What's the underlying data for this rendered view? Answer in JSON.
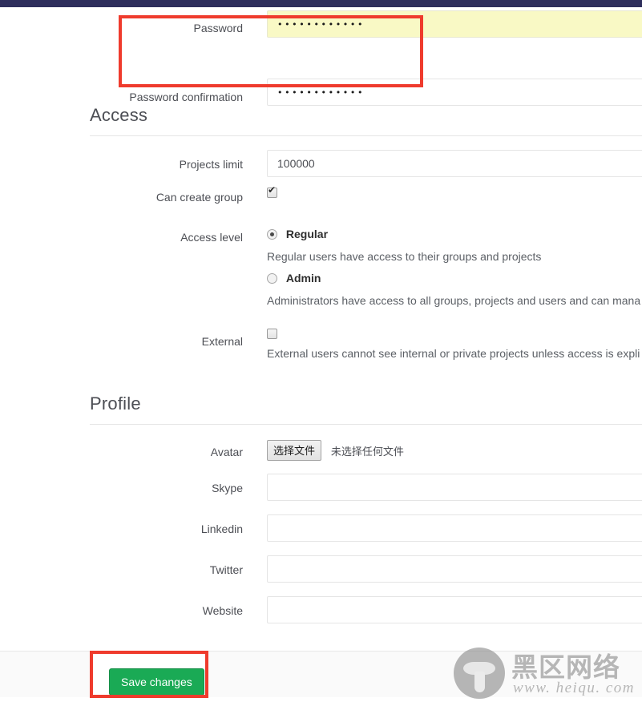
{
  "theme": {
    "topbar_color": "#2e2e5c",
    "accent_green": "#1aaa55",
    "annotation_red": "#ef3b2d",
    "autofill_yellow": "#f9f9c5"
  },
  "password_section": {
    "fields": [
      {
        "label": "Password",
        "value": "••••••••••••",
        "autofilled": true
      },
      {
        "label": "Password confirmation",
        "value": "••••••••••••",
        "autofilled": false
      }
    ]
  },
  "access_section": {
    "title": "Access",
    "projects_limit": {
      "label": "Projects limit",
      "value": "100000"
    },
    "can_create_group": {
      "label": "Can create group",
      "checked": true
    },
    "access_level": {
      "label": "Access level",
      "options": [
        {
          "value": "regular",
          "label": "Regular",
          "selected": true,
          "help": "Regular users have access to their groups and projects"
        },
        {
          "value": "admin",
          "label": "Admin",
          "selected": false,
          "help": "Administrators have access to all groups, projects and users and can mana"
        }
      ]
    },
    "external": {
      "label": "External",
      "checked": false,
      "help": "External users cannot see internal or private projects unless access is expli"
    }
  },
  "profile_section": {
    "title": "Profile",
    "avatar": {
      "label": "Avatar",
      "button_label": "选择文件",
      "status_text": "未选择任何文件"
    },
    "fields": [
      {
        "label": "Skype",
        "value": "",
        "placeholder": ""
      },
      {
        "label": "Linkedin",
        "value": "",
        "placeholder": ""
      },
      {
        "label": "Twitter",
        "value": "",
        "placeholder": ""
      },
      {
        "label": "Website",
        "value": "",
        "placeholder": ""
      }
    ]
  },
  "footer": {
    "save_label": "Save changes"
  },
  "watermark": {
    "chinese_text": "黑区网络",
    "url_text": "www. heiqu. com"
  }
}
